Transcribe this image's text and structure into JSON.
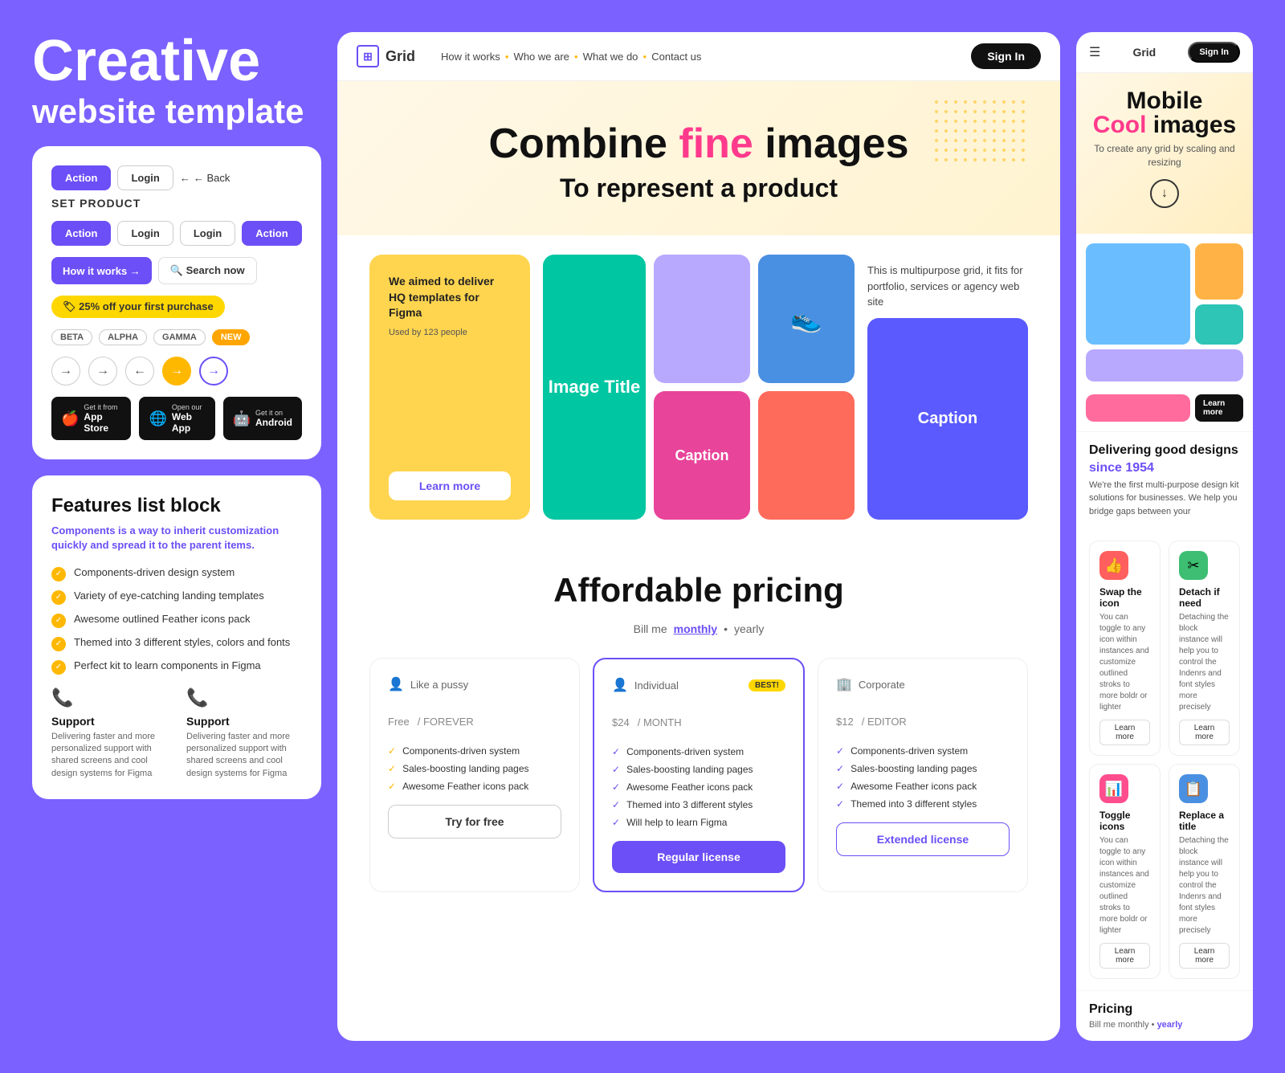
{
  "hero": {
    "title": "Creative",
    "subtitle": "website template"
  },
  "ui_card": {
    "btn1": "Action",
    "btn2": "Login",
    "btn3": "← Back",
    "brand": "SET PRODUCT",
    "btn4": "Action",
    "btn5": "Login",
    "btn6": "Login",
    "btn7": "Action",
    "how_it_works": "How it works →",
    "search_now": "🔍 Search now",
    "discount": "🏷 25% off your first purchase",
    "tags": [
      "BETA",
      "ALPHA",
      "GAMMA",
      "NEW"
    ],
    "store1_top": "Get it from",
    "store1_bottom": "App Store",
    "store2_top": "Open our",
    "store2_bottom": "Web App",
    "store3_top": "Get it on",
    "store3_bottom": "Android"
  },
  "features_card": {
    "title": "Features list block",
    "subtitle": "Components is a way to inherit customization quickly and spread it to the parent items.",
    "items": [
      "Components-driven design system",
      "Variety of eye-catching landing templates",
      "Awesome outlined Feather icons pack",
      "Themed into 3 different styles, colors and fonts",
      "Perfect kit to learn components in Figma"
    ],
    "support_title": "Support",
    "support_desc": "Delivering faster and more personalized support with shared screens and cool design systems for Figma",
    "support2_title": "Support",
    "support2_desc": "Delivering faster and more personalized support with shared screens and cool design systems for Figma"
  },
  "middle": {
    "nav": {
      "logo_icon": "⊞",
      "logo_text": "Grid",
      "links": [
        "How it works",
        "Who we are",
        "What we do",
        "Contact us"
      ],
      "signin": "Sign In"
    },
    "hero": {
      "line1_pre": "Combine ",
      "line1_highlight": "fine",
      "line1_post": " images",
      "line2": "To represent a product"
    },
    "grid": {
      "yellow_card_text": "We aimed to deliver HQ templates for Figma",
      "yellow_card_sub": "Used by 123 people",
      "learn_more": "Learn more",
      "img_title": "Image Title",
      "caption": "Caption",
      "info_text": "This is multipurpose grid, it fits for portfolio, services or agency web site"
    },
    "pricing": {
      "title": "Affordable pricing",
      "billing": "Bill me",
      "monthly": "monthly",
      "yearly": "yearly",
      "plans": [
        {
          "tier_icon": "👤",
          "tier": "Like a pussy",
          "best": false,
          "price": "Free",
          "period": "/ FOREVER",
          "features": [
            "Components-driven system",
            "Sales-boosting landing pages",
            "Awesome Feather icons pack"
          ],
          "btn_label": "Try for free",
          "btn_type": "outline"
        },
        {
          "tier_icon": "👤",
          "tier": "Individual",
          "best": true,
          "best_label": "BEST!",
          "price": "$24",
          "period": "/ MONTH",
          "features": [
            "Components-driven system",
            "Sales-boosting landing pages",
            "Awesome Feather icons pack",
            "Themed into 3 different styles",
            "Will help to learn Figma"
          ],
          "btn_label": "Regular license",
          "btn_type": "primary"
        },
        {
          "tier_icon": "🏢",
          "tier": "Corporate",
          "best": false,
          "price": "$12",
          "period": "/ EDITOR",
          "features": [
            "Components-driven system",
            "Sales-boosting landing pages",
            "Awesome Feather icons pack",
            "Themed into 3 different styles"
          ],
          "btn_label": "Extended license",
          "btn_type": "secondary"
        }
      ]
    }
  },
  "right_panel": {
    "nav": {
      "hamburger": "☰",
      "logo": "Grid",
      "signin": "Sign In"
    },
    "hero": {
      "title": "Mobile",
      "highlight": "Cool",
      "title2": "images",
      "subtitle": "To create any grid by scaling and resizing"
    },
    "learn_more_btn": "Learn more",
    "section1": {
      "title_pre": "Delivering good designs",
      "title_highlight": "since 1954",
      "text": "We're the first multi-purpose design kit solutions for businesses. We help you bridge gaps between your"
    },
    "features": [
      {
        "icon": "👍",
        "icon_color": "red",
        "title": "Swap the icon",
        "desc": "You can toggle to any icon within instances and customize outlined stroks to more boldr or lighter",
        "btn": "Learn more"
      },
      {
        "icon": "✂",
        "icon_color": "green",
        "title": "Detach if need",
        "desc": "Detaching the block instance will help you to control the Indenrs and font styles more precisely",
        "btn": "Learn more"
      },
      {
        "icon": "📊",
        "icon_color": "pink",
        "title": "Toggle icons",
        "desc": "You can toggle to any icon within instances and customize outlined stroks to more boldr or lighter",
        "btn": "Learn more"
      },
      {
        "icon": "📋",
        "icon_color": "blue",
        "title": "Replace a title",
        "desc": "Detaching the block instance will help you to control the Indenrs and font styles more precisely",
        "btn": "Learn more"
      }
    ],
    "pricing": {
      "title": "Pricing",
      "toggle_pre": "Bill me monthly •",
      "toggle_highlight": "yearly"
    }
  }
}
